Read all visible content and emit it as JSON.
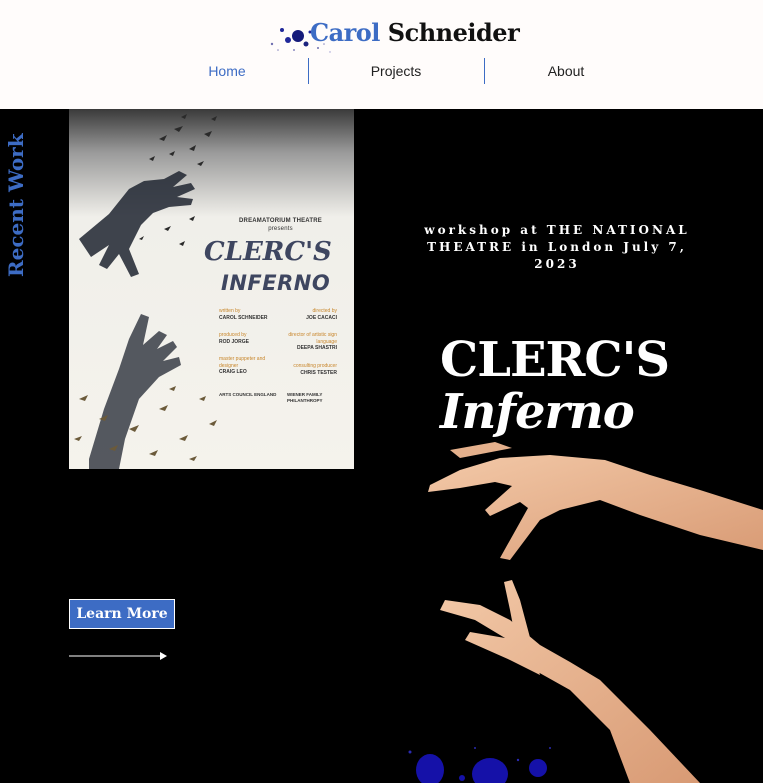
{
  "header": {
    "logo_first": "Carol",
    "logo_last": "Schneider",
    "nav": [
      {
        "label": "Home",
        "active": true
      },
      {
        "label": "Projects",
        "active": false
      },
      {
        "label": "About",
        "active": false
      }
    ]
  },
  "side_label": "Recent Work",
  "poster": {
    "presenter": "DREAMATORIUM THEATRE",
    "presents": "presents",
    "title_line1": "CLERC'S",
    "title_line2": "INFERNO",
    "credits": [
      {
        "role": "written by",
        "name": "CAROL SCHNEIDER"
      },
      {
        "role": "directed by",
        "name": "JOE CACACI"
      },
      {
        "role": "produced by",
        "name": "ROD JORGE"
      },
      {
        "role": "director of artistic sign language",
        "name": "DEEPA SHASTRI"
      },
      {
        "role": "master puppeter and designer",
        "name": "CRAIG LEO"
      },
      {
        "role": "consulting producer",
        "name": "CHRIS TESTER"
      }
    ],
    "funders": [
      "ARTS COUNCIL ENGLAND",
      "WIENER FAMILY PHILANTHROPY"
    ]
  },
  "cta": {
    "learn_more": "Learn More"
  },
  "feature": {
    "workshop": "workshop at THE NATIONAL THEATRE in London July 7, 2023",
    "title_line1": "CLERC'S",
    "title_line2": "Inferno"
  },
  "colors": {
    "accent": "#3d6cc4",
    "header_bg": "#fffcfb",
    "page_bg": "#000000",
    "poster_title": "#3e4660",
    "poster_role": "#c8862b"
  }
}
